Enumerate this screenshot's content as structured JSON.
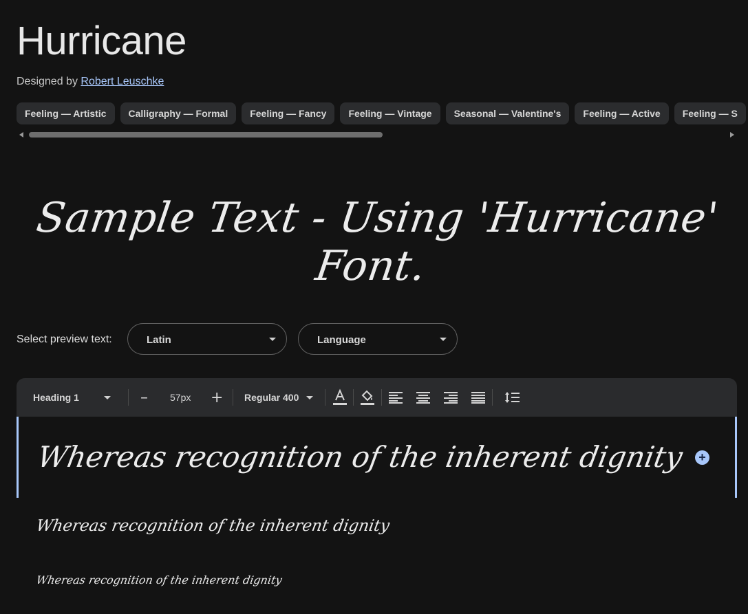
{
  "font": {
    "name": "Hurricane",
    "designed_by_prefix": "Designed by",
    "designer": "Robert Leuschke"
  },
  "tags": [
    "Feeling — Artistic",
    "Calligraphy — Formal",
    "Feeling — Fancy",
    "Feeling — Vintage",
    "Seasonal — Valentine's",
    "Feeling — Active",
    "Feeling — S"
  ],
  "hero_sample": "Sample Text - Using 'Hurricane' Font.",
  "preview": {
    "label": "Select preview text:",
    "script_select": "Latin",
    "language_select": "Language"
  },
  "toolbar": {
    "style": "Heading 1",
    "decrease": "–",
    "size": "57px",
    "increase": "+",
    "weight": "Regular 400",
    "text_color_icon": "A"
  },
  "samples": [
    "Whereas recognition of the inherent dignity",
    "Whereas recognition of the inherent dignity",
    "Whereas recognition of the inherent dignity"
  ],
  "colors": {
    "background": "#131313",
    "chip_bg": "#2b2c2e",
    "accent": "#a8c7fa",
    "toolbar_bg": "#2a2b2d"
  },
  "icons": [
    "text-color-icon",
    "fill-color-icon",
    "align-left-icon",
    "align-center-icon",
    "align-right-icon",
    "align-justify-icon",
    "line-height-icon",
    "add-icon"
  ]
}
